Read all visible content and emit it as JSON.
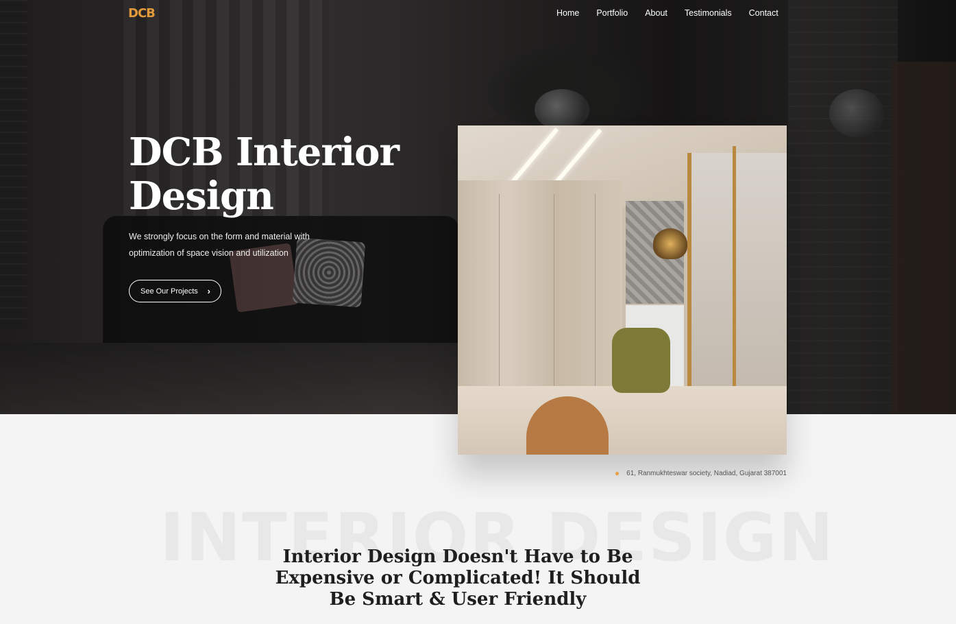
{
  "header": {
    "logo_text": "DCB",
    "nav": [
      "Home",
      "Portfolio",
      "About",
      "Testimonials",
      "Contact"
    ]
  },
  "hero": {
    "title_line1": "DCB Interior",
    "title_line2": "Design",
    "description": "We strongly focus on the form and material with optimization of space vision and utilization",
    "cta_label": "See Our Projects",
    "cta_icon": "chevron-right-icon"
  },
  "feature_image": {
    "address": "61, Ranmukhteswar society, Nadiad, Gujarat 387001",
    "address_icon": "map-pin-icon"
  },
  "section": {
    "watermark": "INTERIOR DESIGN",
    "heading": "Interior Design Doesn't Have to Be Expensive or Complicated! It Should Be Smart & User Friendly"
  },
  "colors": {
    "accent": "#e39a3b",
    "hero_text": "#ffffff",
    "page_bg": "#f4f4f4"
  }
}
